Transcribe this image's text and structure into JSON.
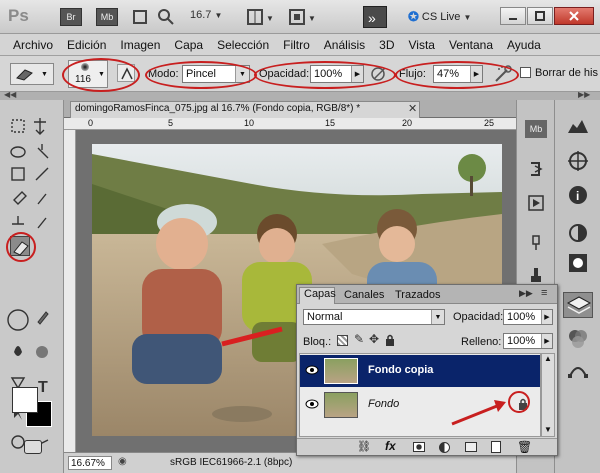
{
  "app": {
    "logo": "Ps",
    "zoom": "16.7",
    "cslive": "CS Live"
  },
  "menu": [
    "Archivo",
    "Edición",
    "Imagen",
    "Capa",
    "Selección",
    "Filtro",
    "Análisis",
    "3D",
    "Vista",
    "Ventana",
    "Ayuda"
  ],
  "options": {
    "brush_size": "116",
    "mode_label": "Modo:",
    "mode_value": "Pincel",
    "opacity_label": "Opacidad:",
    "opacity_value": "100%",
    "flow_label": "Flujo:",
    "flow_value": "47%",
    "erase_history_label": "Borrar de his"
  },
  "document": {
    "tab_title": "domingoRamosFinca_075.jpg al 16.7% (Fondo copia, RGB/8*) *",
    "ruler_marks": [
      "0",
      "5",
      "10",
      "15",
      "20",
      "25"
    ],
    "zoom_field": "16.67%",
    "status_profile": "sRGB IEC61966-2.1 (8bpc)"
  },
  "layers_panel": {
    "tabs": [
      "Capas",
      "Canales",
      "Trazados"
    ],
    "blend_mode": "Normal",
    "opacity_label": "Opacidad:",
    "opacity_value": "100%",
    "lock_label": "Bloq.:",
    "fill_label": "Relleno:",
    "fill_value": "100%",
    "layers": [
      {
        "name": "Fondo copia",
        "selected": true
      },
      {
        "name": "Fondo",
        "selected": false
      }
    ]
  },
  "colors": {
    "accent_red": "#c81f1f",
    "selection_blue": "#0a246a",
    "panel_gray": "#d6d6d6"
  }
}
